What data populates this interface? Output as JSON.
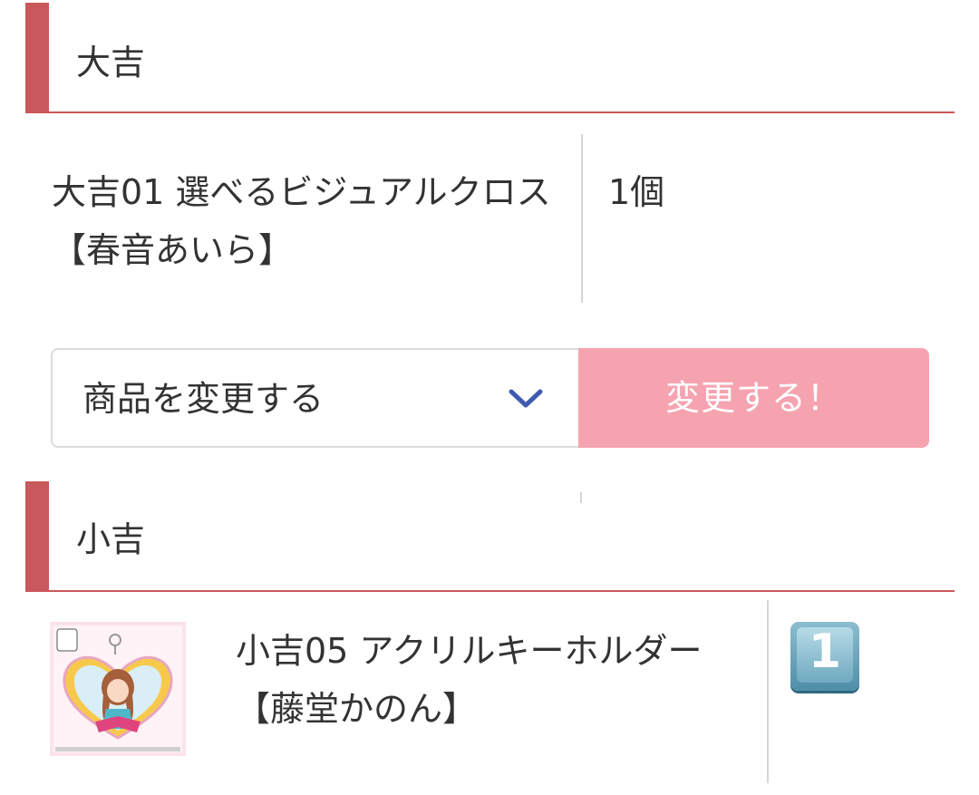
{
  "sections": {
    "daikichi": {
      "title": "大吉",
      "item": {
        "name": "大吉01 選べるビジュアルクロス【春音あいら】",
        "quantity": "1個"
      },
      "select": {
        "label": "商品を変更する"
      },
      "button": {
        "label": "変更する！"
      }
    },
    "shokichi": {
      "title": "小吉",
      "item": {
        "name": "小吉05 アクリルキーホルダー【藤堂かのん】",
        "quantity": "1"
      }
    }
  },
  "colors": {
    "accent": "#c9585c",
    "button_bg": "#f6a3b0",
    "chevron": "#3f5bb0"
  },
  "icons": {
    "select_arrow": "chevron-down-icon",
    "quantity_keycap": "keycap-digit-one-icon"
  }
}
